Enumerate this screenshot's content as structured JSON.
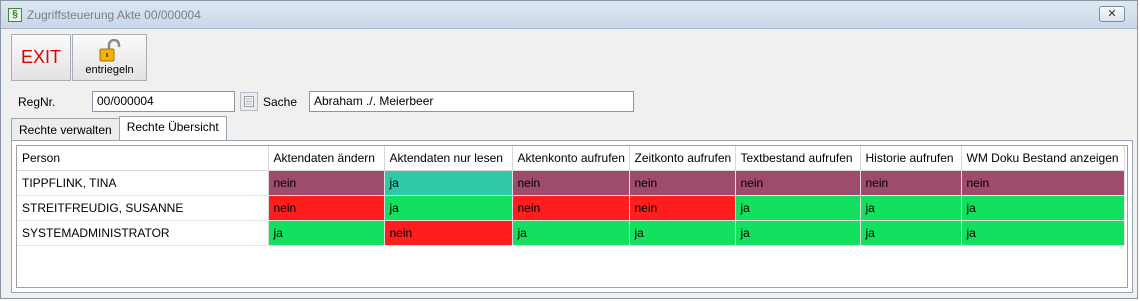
{
  "window": {
    "title": "Zugriffsteuerung Akte 00/000004",
    "app_icon": "§",
    "close_symbol": "✕"
  },
  "toolbar": {
    "exit_label": "EXIT",
    "unlock_label": "entriegeln"
  },
  "form": {
    "regnr_label": "RegNr.",
    "regnr_value": "00/000004",
    "sache_label": "Sache",
    "sache_value": "Abraham ./. Meierbeer"
  },
  "tabs": [
    {
      "label": "Rechte verwalten",
      "active": false
    },
    {
      "label": "Rechte Übersicht",
      "active": true
    }
  ],
  "table": {
    "columns": [
      "Person",
      "Aktendaten ändern",
      "Aktendaten nur lesen",
      "Aktenkonto aufrufen",
      "Zeitkonto aufrufen",
      "Textbestand aufrufen",
      "Historie aufrufen",
      "WM Doku Bestand anzeigen"
    ],
    "rows": [
      {
        "person": "TIPPFLINK, TINA",
        "cells": [
          {
            "value": "nein",
            "color": "#9e4b6e"
          },
          {
            "value": "ja",
            "color": "#2ec9a6"
          },
          {
            "value": "nein",
            "color": "#9e4b6e"
          },
          {
            "value": "nein",
            "color": "#9e4b6e"
          },
          {
            "value": "nein",
            "color": "#9e4b6e"
          },
          {
            "value": "nein",
            "color": "#9e4b6e"
          },
          {
            "value": "nein",
            "color": "#9e4b6e"
          }
        ]
      },
      {
        "person": "STREITFREUDIG, SUSANNE",
        "cells": [
          {
            "value": "nein",
            "color": "#ff1e1e"
          },
          {
            "value": "ja",
            "color": "#14e060"
          },
          {
            "value": "nein",
            "color": "#ff1e1e"
          },
          {
            "value": "nein",
            "color": "#ff1e1e"
          },
          {
            "value": "ja",
            "color": "#14e060"
          },
          {
            "value": "ja",
            "color": "#14e060"
          },
          {
            "value": "ja",
            "color": "#14e060"
          }
        ]
      },
      {
        "person": "SYSTEMADMINISTRATOR",
        "cells": [
          {
            "value": "ja",
            "color": "#14e060"
          },
          {
            "value": "nein",
            "color": "#ff1e1e"
          },
          {
            "value": "ja",
            "color": "#14e060"
          },
          {
            "value": "ja",
            "color": "#14e060"
          },
          {
            "value": "ja",
            "color": "#14e060"
          },
          {
            "value": "ja",
            "color": "#14e060"
          },
          {
            "value": "ja",
            "color": "#14e060"
          }
        ]
      }
    ]
  }
}
